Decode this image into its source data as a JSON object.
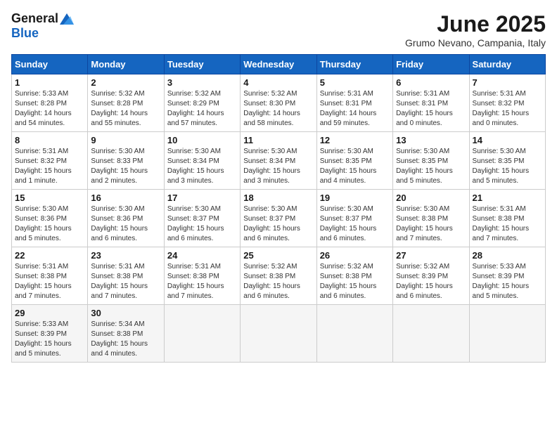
{
  "logo": {
    "general": "General",
    "blue": "Blue"
  },
  "title": "June 2025",
  "subtitle": "Grumo Nevano, Campania, Italy",
  "days_of_week": [
    "Sunday",
    "Monday",
    "Tuesday",
    "Wednesday",
    "Thursday",
    "Friday",
    "Saturday"
  ],
  "weeks": [
    [
      {
        "day": "1",
        "info": "Sunrise: 5:33 AM\nSunset: 8:28 PM\nDaylight: 14 hours\nand 54 minutes."
      },
      {
        "day": "2",
        "info": "Sunrise: 5:32 AM\nSunset: 8:28 PM\nDaylight: 14 hours\nand 55 minutes."
      },
      {
        "day": "3",
        "info": "Sunrise: 5:32 AM\nSunset: 8:29 PM\nDaylight: 14 hours\nand 57 minutes."
      },
      {
        "day": "4",
        "info": "Sunrise: 5:32 AM\nSunset: 8:30 PM\nDaylight: 14 hours\nand 58 minutes."
      },
      {
        "day": "5",
        "info": "Sunrise: 5:31 AM\nSunset: 8:31 PM\nDaylight: 14 hours\nand 59 minutes."
      },
      {
        "day": "6",
        "info": "Sunrise: 5:31 AM\nSunset: 8:31 PM\nDaylight: 15 hours\nand 0 minutes."
      },
      {
        "day": "7",
        "info": "Sunrise: 5:31 AM\nSunset: 8:32 PM\nDaylight: 15 hours\nand 0 minutes."
      }
    ],
    [
      {
        "day": "8",
        "info": "Sunrise: 5:31 AM\nSunset: 8:32 PM\nDaylight: 15 hours\nand 1 minute."
      },
      {
        "day": "9",
        "info": "Sunrise: 5:30 AM\nSunset: 8:33 PM\nDaylight: 15 hours\nand 2 minutes."
      },
      {
        "day": "10",
        "info": "Sunrise: 5:30 AM\nSunset: 8:34 PM\nDaylight: 15 hours\nand 3 minutes."
      },
      {
        "day": "11",
        "info": "Sunrise: 5:30 AM\nSunset: 8:34 PM\nDaylight: 15 hours\nand 3 minutes."
      },
      {
        "day": "12",
        "info": "Sunrise: 5:30 AM\nSunset: 8:35 PM\nDaylight: 15 hours\nand 4 minutes."
      },
      {
        "day": "13",
        "info": "Sunrise: 5:30 AM\nSunset: 8:35 PM\nDaylight: 15 hours\nand 5 minutes."
      },
      {
        "day": "14",
        "info": "Sunrise: 5:30 AM\nSunset: 8:35 PM\nDaylight: 15 hours\nand 5 minutes."
      }
    ],
    [
      {
        "day": "15",
        "info": "Sunrise: 5:30 AM\nSunset: 8:36 PM\nDaylight: 15 hours\nand 5 minutes."
      },
      {
        "day": "16",
        "info": "Sunrise: 5:30 AM\nSunset: 8:36 PM\nDaylight: 15 hours\nand 6 minutes."
      },
      {
        "day": "17",
        "info": "Sunrise: 5:30 AM\nSunset: 8:37 PM\nDaylight: 15 hours\nand 6 minutes."
      },
      {
        "day": "18",
        "info": "Sunrise: 5:30 AM\nSunset: 8:37 PM\nDaylight: 15 hours\nand 6 minutes."
      },
      {
        "day": "19",
        "info": "Sunrise: 5:30 AM\nSunset: 8:37 PM\nDaylight: 15 hours\nand 6 minutes."
      },
      {
        "day": "20",
        "info": "Sunrise: 5:30 AM\nSunset: 8:38 PM\nDaylight: 15 hours\nand 7 minutes."
      },
      {
        "day": "21",
        "info": "Sunrise: 5:31 AM\nSunset: 8:38 PM\nDaylight: 15 hours\nand 7 minutes."
      }
    ],
    [
      {
        "day": "22",
        "info": "Sunrise: 5:31 AM\nSunset: 8:38 PM\nDaylight: 15 hours\nand 7 minutes."
      },
      {
        "day": "23",
        "info": "Sunrise: 5:31 AM\nSunset: 8:38 PM\nDaylight: 15 hours\nand 7 minutes."
      },
      {
        "day": "24",
        "info": "Sunrise: 5:31 AM\nSunset: 8:38 PM\nDaylight: 15 hours\nand 7 minutes."
      },
      {
        "day": "25",
        "info": "Sunrise: 5:32 AM\nSunset: 8:38 PM\nDaylight: 15 hours\nand 6 minutes."
      },
      {
        "day": "26",
        "info": "Sunrise: 5:32 AM\nSunset: 8:38 PM\nDaylight: 15 hours\nand 6 minutes."
      },
      {
        "day": "27",
        "info": "Sunrise: 5:32 AM\nSunset: 8:39 PM\nDaylight: 15 hours\nand 6 minutes."
      },
      {
        "day": "28",
        "info": "Sunrise: 5:33 AM\nSunset: 8:39 PM\nDaylight: 15 hours\nand 5 minutes."
      }
    ],
    [
      {
        "day": "29",
        "info": "Sunrise: 5:33 AM\nSunset: 8:39 PM\nDaylight: 15 hours\nand 5 minutes."
      },
      {
        "day": "30",
        "info": "Sunrise: 5:34 AM\nSunset: 8:38 PM\nDaylight: 15 hours\nand 4 minutes."
      },
      {
        "day": "",
        "info": ""
      },
      {
        "day": "",
        "info": ""
      },
      {
        "day": "",
        "info": ""
      },
      {
        "day": "",
        "info": ""
      },
      {
        "day": "",
        "info": ""
      }
    ]
  ]
}
